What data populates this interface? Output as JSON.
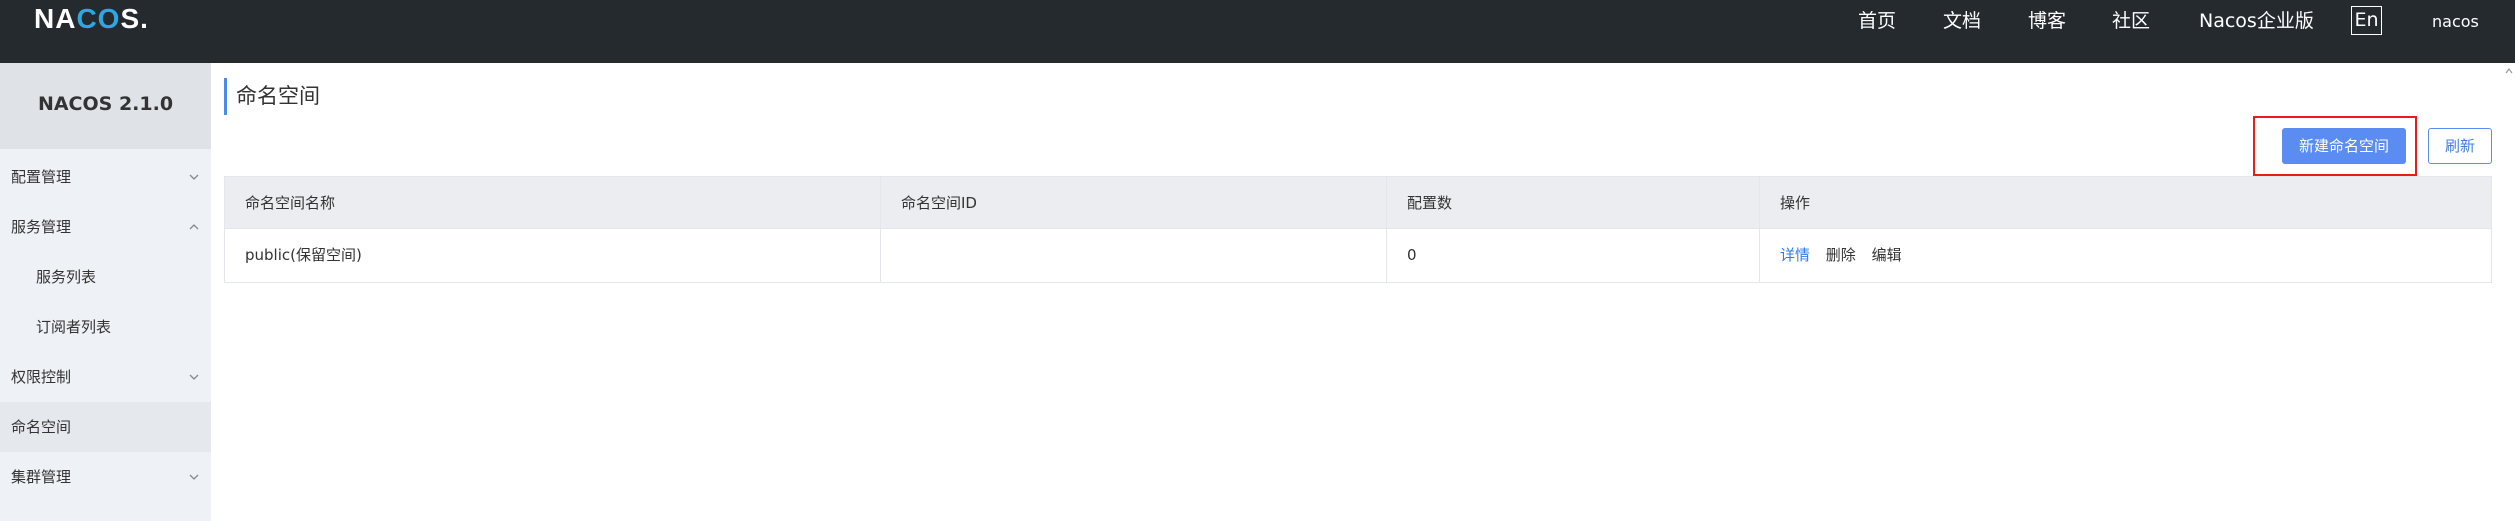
{
  "header": {
    "logo": "NACOS.",
    "nav": [
      "首页",
      "文档",
      "博客",
      "社区",
      "Nacos企业版"
    ],
    "lang": "En",
    "user": "nacos"
  },
  "sidebar": {
    "brand": "NACOS 2.1.0",
    "items": [
      {
        "label": "配置管理",
        "chevron": "down"
      },
      {
        "label": "服务管理",
        "chevron": "up"
      },
      {
        "label": "服务列表"
      },
      {
        "label": "订阅者列表"
      },
      {
        "label": "权限控制",
        "chevron": "down"
      },
      {
        "label": "命名空间",
        "active": true
      },
      {
        "label": "集群管理",
        "chevron": "down"
      }
    ]
  },
  "main": {
    "title": "命名空间",
    "create_button": "新建命名空间",
    "refresh_button": "刷新",
    "table": {
      "headers": [
        "命名空间名称",
        "命名空间ID",
        "配置数",
        "操作"
      ],
      "rows": [
        {
          "name": "public(保留空间)",
          "id": "",
          "count": "0",
          "actions": [
            "详情",
            "删除",
            "编辑"
          ]
        }
      ]
    }
  },
  "colors": {
    "topbar": "#252a2f",
    "primary": "#5b8cf2",
    "highlight": "#e81c1c",
    "link": "#2f7be8"
  }
}
